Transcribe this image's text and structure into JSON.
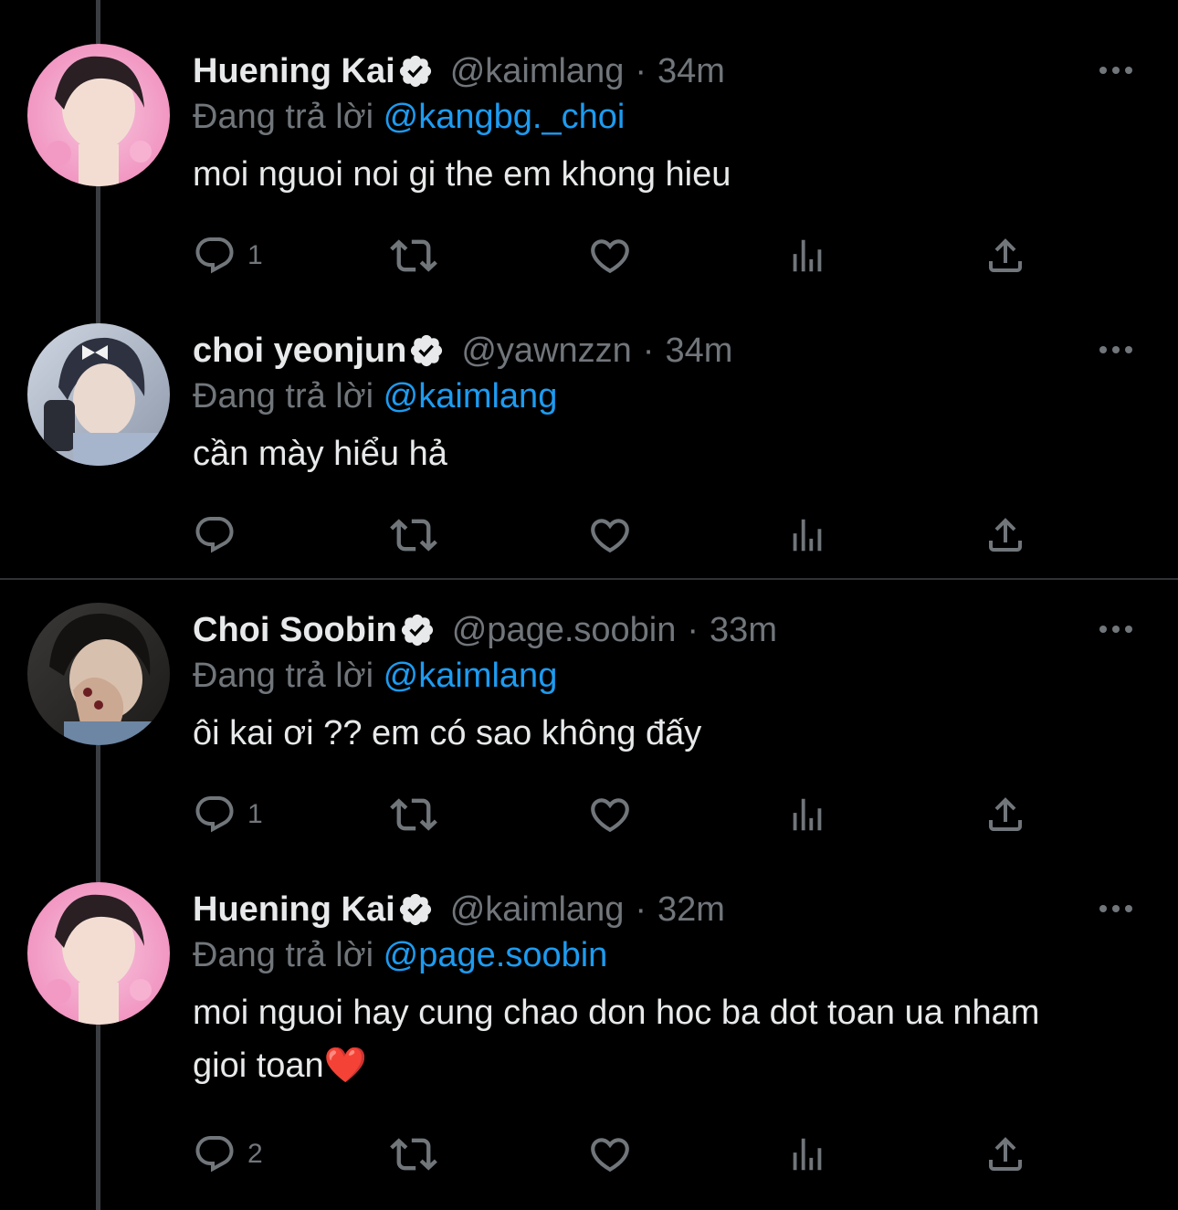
{
  "colors": {
    "background": "#000000",
    "text": "#e7e9ea",
    "secondary": "#71767b",
    "accent": "#1d9bf0",
    "thread_line": "#3a3d41",
    "divider": "#2f3336"
  },
  "tweets": [
    {
      "display_name": "Huening Kai",
      "handle": "@kaimlang",
      "separator": "·",
      "time": "34m",
      "replying_prefix": "Đang trả lời",
      "replying_to": "@kangbg._choi",
      "text": "moi nguoi noi gi the em khong hieu",
      "reply_count": "1"
    },
    {
      "display_name": "choi yeonjun",
      "handle": "@yawnzzn",
      "separator": "·",
      "time": "34m",
      "replying_prefix": "Đang trả lời",
      "replying_to": "@kaimlang",
      "text": "cần mày hiểu hả",
      "reply_count": ""
    },
    {
      "display_name": "Choi Soobin",
      "handle": "@page.soobin",
      "separator": "·",
      "time": "33m",
      "replying_prefix": "Đang trả lời",
      "replying_to": "@kaimlang",
      "text": "ôi kai ơi ?? em có sao không đấy",
      "reply_count": "1"
    },
    {
      "display_name": "Huening Kai",
      "handle": "@kaimlang",
      "separator": "·",
      "time": "32m",
      "replying_prefix": "Đang trả lời",
      "replying_to": "@page.soobin",
      "text": "moi nguoi hay cung chao don hoc ba dot toan ua nham gioi toan❤️",
      "reply_count": "2"
    }
  ],
  "icons": {
    "reply": "reply-icon",
    "retweet": "retweet-icon",
    "like": "heart-icon",
    "views": "views-icon",
    "share": "share-icon",
    "verified": "verified-badge-icon",
    "more": "more-icon"
  }
}
